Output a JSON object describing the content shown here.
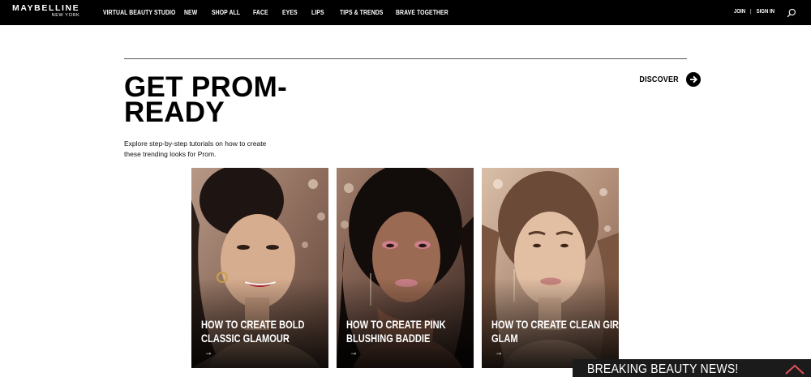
{
  "brand": {
    "logo_main": "MAYBELLINE",
    "logo_sub": "NEW YORK"
  },
  "nav": {
    "items": [
      "VIRTUAL BEAUTY STUDIO",
      "NEW",
      "SHOP ALL",
      "FACE",
      "EYES",
      "LIPS",
      "TIPS & TRENDS",
      "BRAVE TOGETHER"
    ],
    "join_label": "JOIN",
    "separator": "|",
    "signin_label": "SIGN IN",
    "search_icon": "search-icon"
  },
  "hero": {
    "title_line1": "GET PROM-",
    "title_line2": "READY",
    "description": "Explore step-by-step tutorials on how to create these trending looks for Prom.",
    "discover_label": "DISCOVER",
    "discover_icon": "arrow-right-circle-icon"
  },
  "cards": [
    {
      "line1": "HOW TO CREATE BOLD",
      "line2": "CLASSIC GLAMOUR",
      "arrow": "→"
    },
    {
      "line1": "HOW TO CREATE PINK",
      "line2": "BLUSHING BADDIE",
      "arrow": "→"
    },
    {
      "line1": "HOW TO CREATE CLEAN GIRL",
      "line2": "GLAM",
      "arrow": "→"
    }
  ],
  "news_banner": {
    "label": "BREAKING BEAUTY NEWS!",
    "icon": "chevron-up-icon"
  },
  "colors": {
    "nav_bg": "#000000",
    "page_bg": "#ffffff",
    "accent_pink": "#e07a8c",
    "news_chevron": "#e0505a"
  }
}
